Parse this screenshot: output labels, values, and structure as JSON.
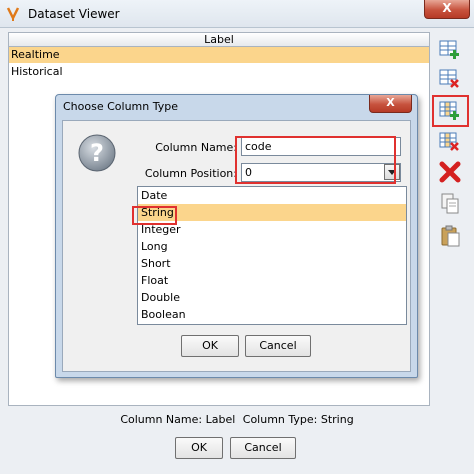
{
  "window": {
    "title": "Dataset Viewer",
    "close_label": "X"
  },
  "table": {
    "column_header": "Label",
    "rows": [
      "Realtime",
      "Historical"
    ],
    "selected_row": 0
  },
  "toolbar": {
    "icons": [
      "add-row-icon",
      "delete-row-icon",
      "add-column-icon",
      "delete-column-icon",
      "delete-icon",
      "copy-icon",
      "paste-icon"
    ],
    "highlighted": "add-column-icon"
  },
  "status": {
    "column_name_text": "Column Name: Label",
    "column_type_text": "Column Type: String"
  },
  "buttons": {
    "ok_label": "OK",
    "cancel_label": "Cancel"
  },
  "dialog": {
    "title": "Choose Column Type",
    "close_label": "X",
    "column_name_label": "Column Name:",
    "column_name_value": "code",
    "column_position_label": "Column Position:",
    "column_position_value": "0",
    "types": [
      "Date",
      "String",
      "Integer",
      "Long",
      "Short",
      "Float",
      "Double",
      "Boolean"
    ],
    "selected_type": "String",
    "ok_label": "OK",
    "cancel_label": "Cancel"
  },
  "colors": {
    "selection": "#fbd58c",
    "highlight_red": "#e0312f",
    "dialog_frame": "#c8d8ea"
  }
}
